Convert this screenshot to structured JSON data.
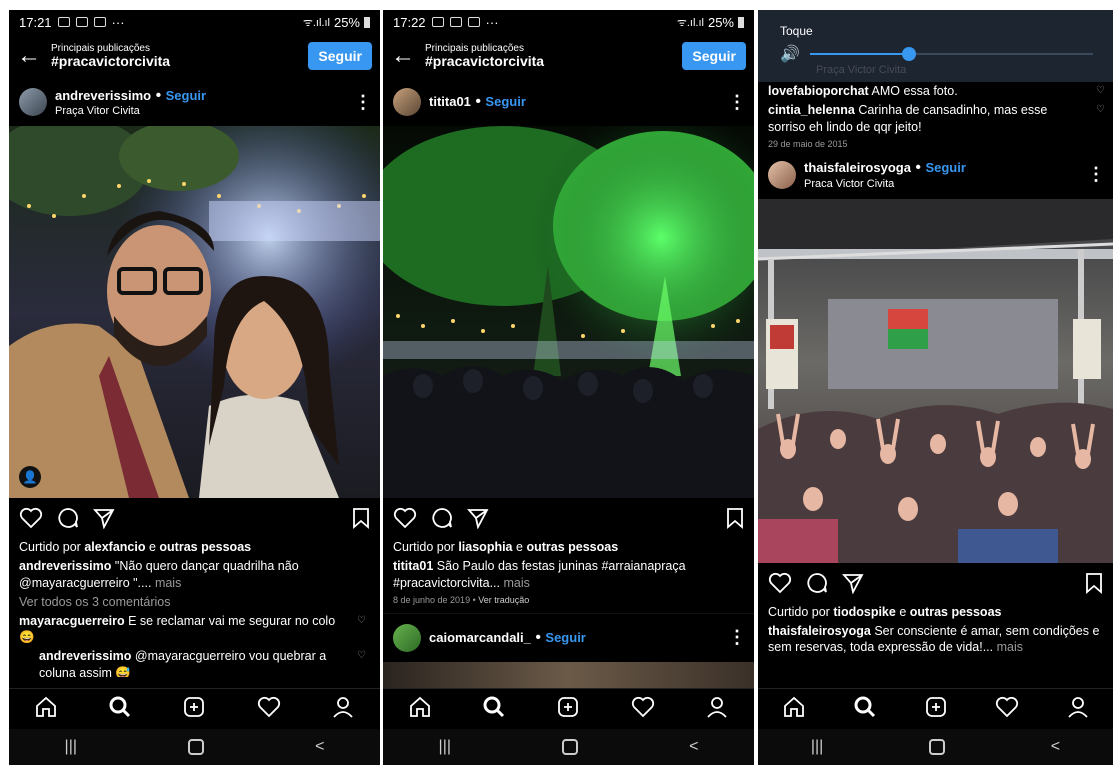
{
  "status1": {
    "time": "17:21",
    "dots": "···",
    "battery": "25%"
  },
  "status2": {
    "time": "17:22",
    "dots": "···",
    "battery": "25%"
  },
  "header": {
    "subtitle": "Principais publicações",
    "hashtag": "#pracavictorcivita",
    "follow": "Seguir"
  },
  "post1": {
    "user": "andreverissimo",
    "follow": "Seguir",
    "location": "Praça Vitor Civita",
    "liked_prefix": "Curtido por",
    "liked_user": "alexfancio",
    "liked_and": "e",
    "liked_others": "outras pessoas",
    "caption_user": "andreverissimo",
    "caption": "\"Não quero dançar quadrilha não @mayaracguerreiro \"....",
    "caption_more": "mais",
    "view_comments": "Ver todos os 3 comentários",
    "comment1_user": "mayaracguerreiro",
    "comment1": "E se reclamar vai me segurar no colo 😄",
    "comment2_user": "andreverissimo",
    "comment2": "@mayaracguerreiro vou quebrar a coluna assim 😅"
  },
  "post2": {
    "user": "titita01",
    "follow": "Seguir",
    "liked_prefix": "Curtido por",
    "liked_user": "liasophia",
    "liked_and": "e",
    "liked_others": "outras pessoas",
    "caption_user": "titita01",
    "caption": "São Paulo das festas juninas #arraianapraça #pracavictorcivita...",
    "caption_more": "mais",
    "date": "8 de junho de 2019",
    "translate": "Ver tradução",
    "next_user": "caiomarcandali_",
    "next_follow": "Seguir"
  },
  "post3": {
    "overlay_label": "Toque",
    "overlay_location": "Praça Victor Civita",
    "comment1_user": "lovefabioporchat",
    "comment1": "AMO essa foto.",
    "comment2_user": "cintia_helenna",
    "comment2": "Carinha de cansadinho, mas esse sorriso eh lindo de qqr jeito!",
    "comment_date": "29 de maio de 2015",
    "user": "thaisfaleirosyoga",
    "follow": "Seguir",
    "location": "Praca Victor Civita",
    "liked_prefix": "Curtido por",
    "liked_user": "tiodospike",
    "liked_and": "e",
    "liked_others": "outras pessoas",
    "caption_user": "thaisfaleirosyoga",
    "caption": "Ser consciente é amar, sem condições e sem reservas, toda expressão de vida!...",
    "caption_more": "mais"
  },
  "nav": {
    "items": [
      "home-icon",
      "search-icon",
      "add-icon",
      "heart-icon",
      "profile-icon"
    ]
  },
  "sysnav": {
    "recent": "|||",
    "back": "<"
  },
  "colors": {
    "accent": "#3897f0",
    "background": "#000000"
  }
}
